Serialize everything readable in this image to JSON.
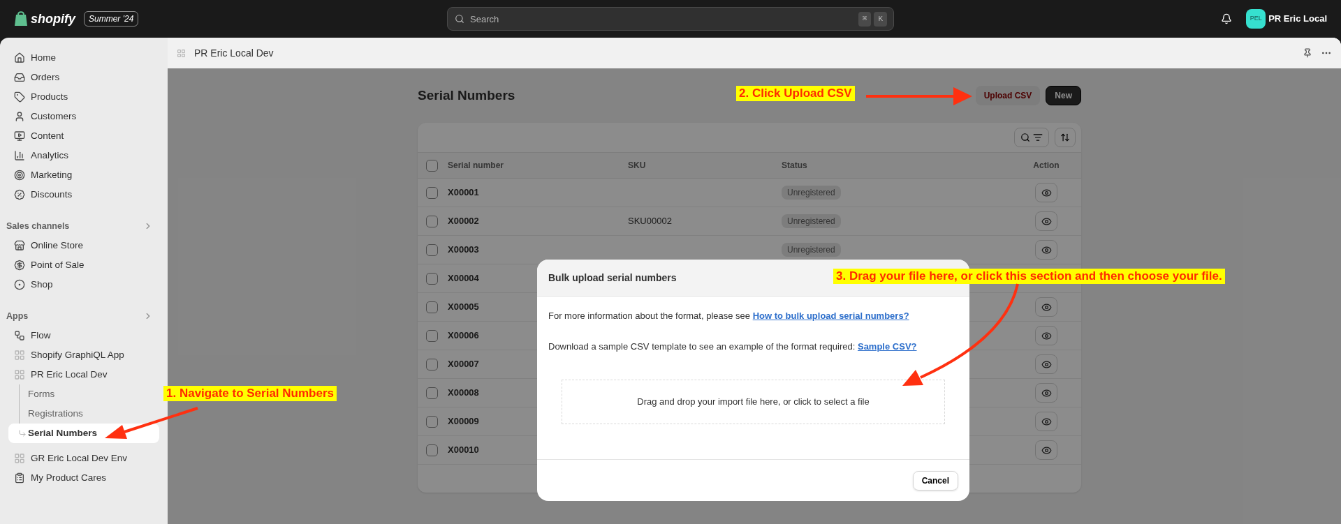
{
  "topbar": {
    "logo": "shopify",
    "edition": "Summer '24",
    "search": {
      "placeholder": "Search",
      "keys": [
        "⌘",
        "K"
      ]
    },
    "avatar": "PEL",
    "store": "PR Eric Local"
  },
  "sidebar": {
    "items": [
      {
        "label": "Home",
        "selected": false
      },
      {
        "label": "Orders",
        "selected": false
      },
      {
        "label": "Products",
        "selected": false
      },
      {
        "label": "Customers",
        "selected": false
      },
      {
        "label": "Content",
        "selected": false
      },
      {
        "label": "Analytics",
        "selected": false
      },
      {
        "label": "Marketing",
        "selected": false
      },
      {
        "label": "Discounts",
        "selected": false
      }
    ],
    "sections": [
      {
        "title": "Sales channels",
        "items": [
          {
            "label": "Online Store",
            "selected": false
          },
          {
            "label": "Point of Sale",
            "selected": false
          },
          {
            "label": "Shop",
            "selected": false
          }
        ]
      },
      {
        "title": "Apps",
        "items": [
          {
            "label": "Flow",
            "selected": false
          },
          {
            "label": "Shopify GraphiQL App",
            "selected": false
          },
          {
            "label": "PR Eric Local Dev",
            "selected": false,
            "children": [
              {
                "label": "Forms",
                "selected": false
              },
              {
                "label": "Registrations",
                "selected": false
              },
              {
                "label": "Serial Numbers",
                "selected": true
              }
            ]
          },
          {
            "label": "GR Eric Local Dev Env",
            "selected": false
          },
          {
            "label": "My Product Cares",
            "selected": false
          }
        ]
      }
    ]
  },
  "app_header": {
    "title": "PR Eric Local Dev"
  },
  "page": {
    "title": "Serial Numbers",
    "buttons": [
      "Upload CSV",
      "New"
    ],
    "table": {
      "all_checked": false,
      "columns": [
        "Serial number",
        "SKU",
        "Status",
        "Action"
      ],
      "rows": [
        {
          "serial": "X00001",
          "status": "Unregistered",
          "checked": false,
          "view": true
        },
        {
          "serial": "X00002",
          "sku": "SKU00002",
          "status": "Unregistered",
          "checked": false,
          "view": true
        },
        {
          "serial": "X00003",
          "status": "Unregistered",
          "checked": false,
          "view": true
        },
        {
          "serial": "X00004",
          "checked": false,
          "view": false
        },
        {
          "serial": "X00005",
          "checked": false,
          "view": true
        },
        {
          "serial": "X00006",
          "checked": false,
          "view": true
        },
        {
          "serial": "X00007",
          "checked": false,
          "view": true
        },
        {
          "serial": "X00008",
          "checked": false,
          "view": true
        },
        {
          "serial": "X00009",
          "checked": false,
          "view": true
        },
        {
          "serial": "X00010",
          "checked": false,
          "view": true
        }
      ]
    }
  },
  "modal": {
    "title": "Bulk upload serial numbers",
    "lines": [
      {
        "text": "For more information about the format, please see ",
        "link": "How to bulk upload serial numbers?"
      },
      {
        "text": "Download a sample CSV template to see an example of the format required: ",
        "link": "Sample CSV?"
      }
    ],
    "dropzone": "Drag and drop your import file here, or click to select a file",
    "cancel": "Cancel"
  },
  "annotations": [
    "1. Navigate to Serial Numbers",
    "2. Click Upload CSV",
    "3. Drag your file here, or click this section and then choose your file."
  ]
}
